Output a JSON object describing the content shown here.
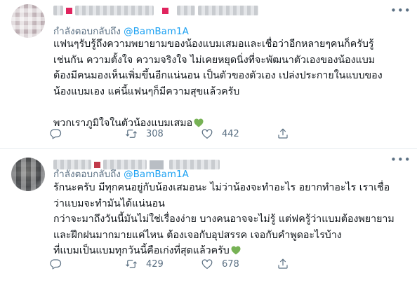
{
  "tweets": [
    {
      "replying_prefix": "กำลังตอบกลับถึง",
      "handle": "@BamBam1A",
      "lines": [
        "แฟนๆรับรู้ถึงความพยายามของน้องแบมเสมอและเชื่อว่าอีกหลายๆคนก็ครับรู้",
        "เช่นกัน ความตั้งใจ ความจริงใจ ไม่เคยหยุดนิ่งที่จะพัฒนาตัวเองของน้องแบม",
        "ต้องมีคนมองเห็นเพิ่มขึ้นอีกแน่นอน เป็นตัวของตัวเอง เปล่งประกายในแบบของ",
        "น้องแบมเอง แค่นี้แฟนๆก็มีความสุขแล้วครับ"
      ],
      "closing_line": "พวกเราภูมิใจในตัวน้องแบมเสมอ",
      "retweet_count": "308",
      "like_count": "442"
    },
    {
      "replying_prefix": "กำลังตอบกลับถึง",
      "handle": "@BamBam1A",
      "lines": [
        "รักนะครับ มีทุกคนอยู่กับน้องเสมอนะ ไม่ว่าน้องจะทำอะไร อยากทำอะไร เราเชื่อ",
        "ว่าแบมจะทำมันได้แน่นอน",
        "กว่าจะมาถึงวันนี้มันไม่ใช่เรื่องง่าย บางคนอาจจะไม่รู้ แต่ฟครู้ว่าแบมต้องพยายาม",
        "และฝึกฝนมากมายแค่ไหน ต้องเจอกับอุปสรรค เจอกับคำพูดอะไรบ้าง",
        "ที่แบมเป็นแบมทุกวันนี้คือเก่งที่สุดแล้วครับ"
      ],
      "retweet_count": "429",
      "like_count": "678"
    }
  ],
  "colors": {
    "link": "#1da1f2",
    "muted": "#5b7083",
    "heart": "#77b255"
  },
  "icons": [
    "more-icon",
    "reply-icon",
    "retweet-icon",
    "like-icon",
    "share-icon",
    "green-heart-emoji"
  ]
}
